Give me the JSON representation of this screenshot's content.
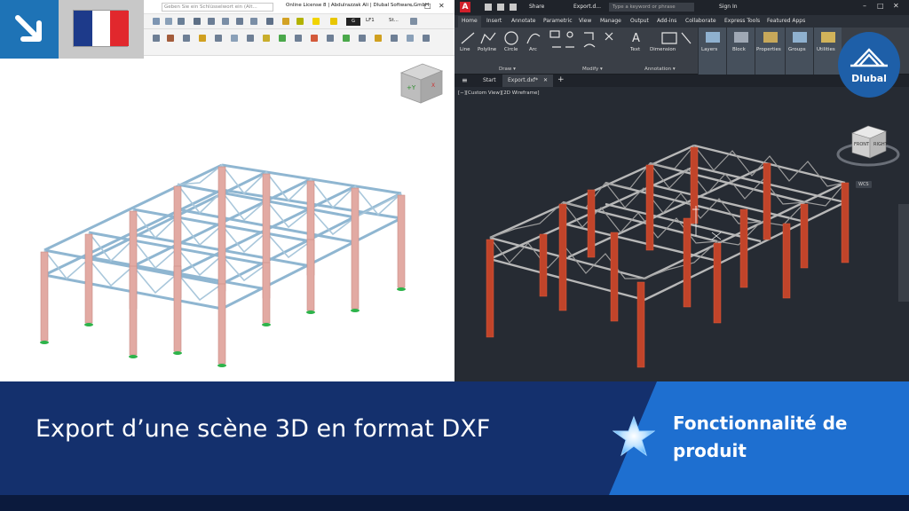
{
  "left_app": {
    "search_placeholder": "Geben Sie ein Schlüsselwort ein (Alt...",
    "license_text": "Online License 8 | Abdulrazzak Ali | Dlubal Software GmbH",
    "load_case_label": "LF1",
    "load_case_code": "G",
    "view_combo": "St...",
    "navcube_axis": "+Y",
    "navcube_axis_x": "X"
  },
  "right_app": {
    "app_letter": "A",
    "share_label": "Share",
    "doc_title": "Export.d...",
    "search_placeholder": "Type a keyword or phrase",
    "sign_in": "Sign In",
    "tabs": [
      "Home",
      "Insert",
      "Annotate",
      "Parametric",
      "View",
      "Manage",
      "Output",
      "Add-ins",
      "Collaborate",
      "Express Tools",
      "Featured Apps"
    ],
    "draw_tools": [
      "Line",
      "Polyline",
      "Circle",
      "Arc"
    ],
    "text_tools": [
      "Text",
      "Dimension"
    ],
    "big_tools": [
      "Layers",
      "Block",
      "Properties",
      "Groups",
      "Utilities"
    ],
    "panels": {
      "draw": "Draw ▾",
      "modify": "Modify ▾",
      "annotation": "Annotation ▾"
    },
    "file_tabs": {
      "start": "Start",
      "export": "Export.dxf*"
    },
    "view_label": "[−][Custom View][2D Wireframe]",
    "viewcube_front": "FRONT",
    "viewcube_right": "RIGHT",
    "wcs_label": "WCS"
  },
  "brand": {
    "name": "Dlubal"
  },
  "banner": {
    "title": "Export d’une scène 3D en format DXF",
    "feature": "Fonctionnalité de produit"
  },
  "colors": {
    "banner": "#14306d",
    "banner_accent": "#1e6fd0",
    "flag_blue": "#1d3a8a",
    "flag_white": "#ffffff",
    "flag_red": "#e1282d",
    "column_red": "#cc4b2b",
    "truss_blue": "#9ec3dc"
  },
  "icons": [
    "arrow-down-right-icon",
    "star-icon",
    "dlubal-logo-icon",
    "navcube-icon",
    "viewcube-icon"
  ]
}
